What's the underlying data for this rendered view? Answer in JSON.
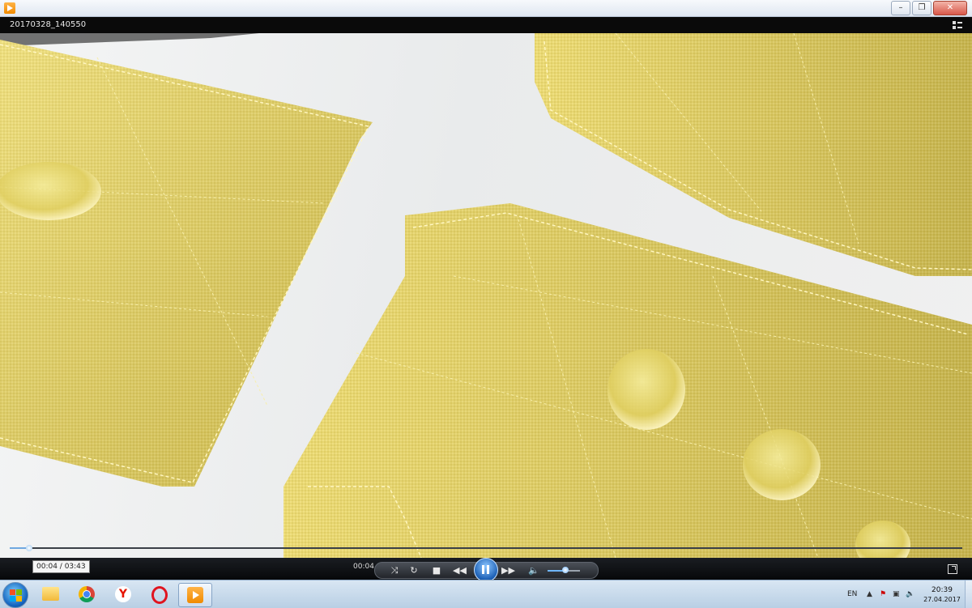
{
  "window": {
    "title": "20170328_140550"
  },
  "player": {
    "current_time": "00:04",
    "tooltip": "00:04 / 03:43",
    "progress": 0.02,
    "volume": 0.55
  },
  "taskbar": {
    "lang": "EN",
    "time": "20:39",
    "date": "27.04.2017"
  },
  "colors": {
    "fabric": "#e6d36a",
    "seek_fill": "#6fa8e0",
    "taskbar": "#c6d8ea"
  }
}
